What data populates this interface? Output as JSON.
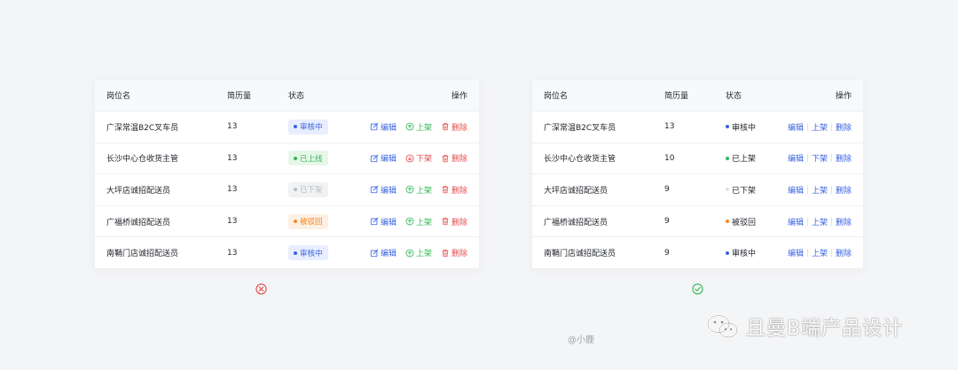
{
  "headers": {
    "name": "岗位名",
    "count": "简历量",
    "status": "状态",
    "ops": "操作"
  },
  "left_table": {
    "rows": [
      {
        "name": "广深常温B2C叉车员",
        "count": "13",
        "status": "审核中",
        "status_kind": "review",
        "shelf": "上架",
        "shelf_kind": "up"
      },
      {
        "name": "长沙中心仓收货主管",
        "count": "13",
        "status": "已上线",
        "status_kind": "online",
        "shelf": "下架",
        "shelf_kind": "down"
      },
      {
        "name": "大坪店诚招配送员",
        "count": "13",
        "status": "已下架",
        "status_kind": "off",
        "shelf": "上架",
        "shelf_kind": "up"
      },
      {
        "name": "广福桥诚招配送员",
        "count": "13",
        "status": "被驳回",
        "status_kind": "rejected",
        "shelf": "上架",
        "shelf_kind": "up"
      },
      {
        "name": "南鞘门店诚招配送员",
        "count": "13",
        "status": "审核中",
        "status_kind": "review",
        "shelf": "上架",
        "shelf_kind": "up"
      }
    ],
    "edit_label": "编辑",
    "delete_label": "删除"
  },
  "right_table": {
    "rows": [
      {
        "name": "广深常温B2C叉车员",
        "count": "13",
        "status": "审核中",
        "status_kind": "review",
        "shelf": "上架"
      },
      {
        "name": "长沙中心仓收货主管",
        "count": "10",
        "status": "已上架",
        "status_kind": "online",
        "shelf": "下架"
      },
      {
        "name": "大坪店诚招配送员",
        "count": "9",
        "status": "已下架",
        "status_kind": "off",
        "shelf": "上架"
      },
      {
        "name": "广福桥诚招配送员",
        "count": "9",
        "status": "被驳回",
        "status_kind": "rejected",
        "shelf": "上架"
      },
      {
        "name": "南鞘门店诚招配送员",
        "count": "9",
        "status": "审核中",
        "status_kind": "review",
        "shelf": "上架"
      }
    ],
    "edit_label": "编辑",
    "delete_label": "删除"
  },
  "colors": {
    "review": "#3a62e0",
    "online": "#34b856",
    "off": "#c8ccd2",
    "rejected": "#f08a24",
    "danger": "#e34d4d",
    "link": "#3a62e0",
    "wrong": "#e34d4d",
    "right": "#34b856"
  },
  "markers": {
    "left": "wrong-icon",
    "right": "check-icon"
  },
  "author": "@小鹿",
  "brand": "且曼B端产品设计"
}
